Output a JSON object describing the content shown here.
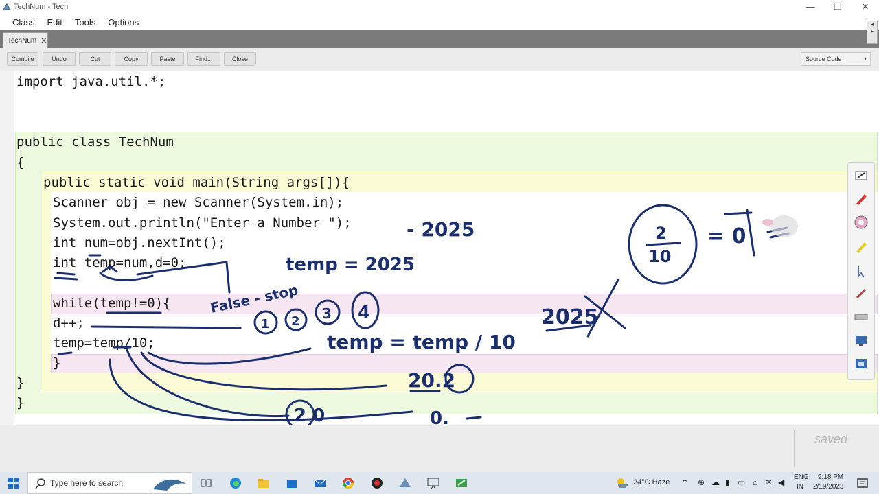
{
  "window": {
    "title": "TechNum - Tech",
    "controls": [
      "—",
      "❐",
      "✕"
    ]
  },
  "menu": {
    "items": [
      "Class",
      "Edit",
      "Tools",
      "Options"
    ]
  },
  "tab": {
    "label": "TechNum",
    "close": "✕"
  },
  "toolbar": {
    "buttons": [
      "Compile",
      "Undo",
      "Cut",
      "Copy",
      "Paste",
      "Find...",
      "Close"
    ],
    "view_select": "Source Code"
  },
  "code": {
    "lines": [
      "import java.util.*;",
      "public class TechNum",
      "{",
      "public static void main(String args[]){",
      "Scanner obj = new Scanner(System.in);",
      "System.out.println(\"Enter a Number \");",
      "int num=obj.nextInt();",
      "int temp=num,d=0;",
      "while(temp!=0){",
      "d++;",
      "temp=temp/10;",
      "}",
      "}",
      "}"
    ]
  },
  "annotations": {
    "input_value": "- 2025",
    "temp_assign": "temp = 2025",
    "false_stop": "False - stop",
    "counts": [
      "1",
      "2",
      "3",
      "4"
    ],
    "division": "temp = temp / 10",
    "struck": "2025",
    "frac_num": "2",
    "frac_den": "10",
    "equals": "= 0",
    "r1": "20.2",
    "r2": "2 0",
    "r3": "0."
  },
  "status": {
    "saved": "saved"
  },
  "taskbar": {
    "search_placeholder": "Type here to search",
    "weather": "24°C  Haze",
    "lang1": "ENG",
    "lang2": "IN",
    "time": "9:18 PM",
    "date": "2/19/2023"
  },
  "colors": {
    "ink": "#1b2f6e",
    "class_scope": "#eefae0",
    "method_scope": "#fbfbd6",
    "loop_scope": "#f6e6f2"
  }
}
